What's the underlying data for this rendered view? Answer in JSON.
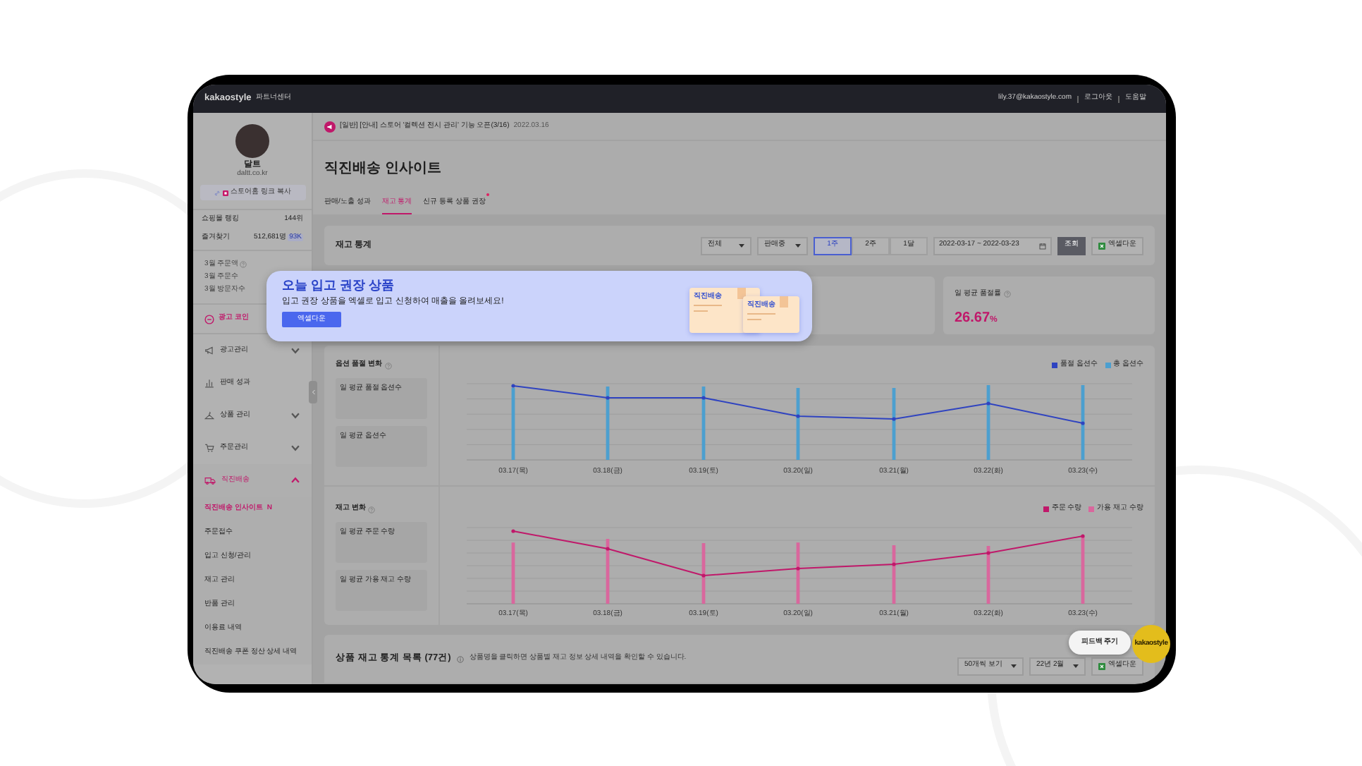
{
  "header": {
    "logo": "kakaostyle",
    "logo_suffix": "파트너센터",
    "links": [
      "lily.37@kakaostyle.com",
      "로그아웃",
      "도움말"
    ]
  },
  "sidebar": {
    "store_name": "달트",
    "store_url": "daltt.co.kr",
    "copy_link_button": "스토어홈 링크 복사",
    "stats": [
      {
        "label": "쇼핑몰 랭킹",
        "value": "144위"
      },
      {
        "label": "즐겨찾기",
        "value": "512,681명",
        "badge": "93K"
      }
    ],
    "monthly": [
      {
        "label": "3월 주문액",
        "help": true
      },
      {
        "label": "3월 주문수",
        "help": false
      },
      {
        "label": "3월 방문자수",
        "help": false
      }
    ],
    "ad_coin": "광고 코인",
    "menu": [
      {
        "label": "광고관리",
        "kind": "group",
        "expanded": false,
        "selected": false
      },
      {
        "label": "판매 성과",
        "kind": "link",
        "selected": false
      },
      {
        "label": "상품 관리",
        "kind": "group",
        "expanded": false,
        "selected": false
      },
      {
        "label": "주문관리",
        "kind": "group",
        "expanded": false,
        "selected": false
      },
      {
        "label": "직진배송",
        "kind": "group",
        "expanded": true,
        "selected": true,
        "children": [
          {
            "label": "직진배송 인사이트",
            "badge": "N",
            "selected": true
          },
          {
            "label": "주문접수",
            "selected": false
          },
          {
            "label": "입고 신청/관리",
            "selected": false
          },
          {
            "label": "재고 관리",
            "selected": false
          },
          {
            "label": "반품 관리",
            "selected": false
          },
          {
            "label": "이용료 내역",
            "selected": false
          },
          {
            "label": "직진배송 쿠폰 정산 상세 내역",
            "selected": false
          }
        ]
      }
    ]
  },
  "notice": {
    "text": "[일반] [안내] 스토어 '컬렉션 전시 관리' 기능 오픈(3/16)",
    "date": "2022.03.16"
  },
  "page_title": "직진배송 인사이트",
  "tabs": [
    {
      "label": "판매/노출 성과",
      "selected": false,
      "new_dot": false
    },
    {
      "label": "재고 통계",
      "selected": true,
      "new_dot": false
    },
    {
      "label": "신규 등록 상품 권장",
      "selected": false,
      "new_dot": true
    }
  ],
  "filter": {
    "title": "재고 통계",
    "selects": [
      "전체",
      "판매중"
    ],
    "periods": [
      {
        "label": "1주",
        "selected": true
      },
      {
        "label": "2주",
        "selected": false
      },
      {
        "label": "1달",
        "selected": false
      }
    ],
    "date_range": "2022-03-17 ~ 2022-03-23",
    "search_button": "조회",
    "excel_button": "엑셀다운"
  },
  "stat": {
    "label": "일 평균 품절률",
    "value": "26.67",
    "unit": "%"
  },
  "charts": [
    {
      "title": "옵션 품절 변화",
      "metrics": [
        "일 평균 품절 옵션수",
        "일 평균 옵션수"
      ],
      "legend": [
        {
          "label": "품절 옵션수",
          "color": "#2f43c0"
        },
        {
          "label": "총 옵션수",
          "color": "#4c9fcf"
        }
      ],
      "x_labels": [
        "03.17(목)",
        "03.18(금)",
        "03.19(토)",
        "03.20(일)",
        "03.21(월)",
        "03.22(화)",
        "03.23(수)"
      ]
    },
    {
      "title": "재고 변화",
      "metrics": [
        "일 평균 주문 수량",
        "일 평균 가용 재고 수량"
      ],
      "legend": [
        {
          "label": "주문 수량",
          "color": "#c0186a"
        },
        {
          "label": "가용 재고 수량",
          "color": "#d9679d"
        }
      ],
      "x_labels": [
        "03.17(목)",
        "03.18(금)",
        "03.19(토)",
        "03.20(일)",
        "03.21(월)",
        "03.22(화)",
        "03.23(수)"
      ]
    }
  ],
  "list": {
    "title": "상품 재고 통계 목록 (77건)",
    "hint": "상품명을 클릭하면 상품별 재고 정보 상세 내역을 확인할 수 있습니다.",
    "page_size": "50개씩 보기",
    "month": "22년 2월",
    "excel_button": "엑셀다운"
  },
  "popup": {
    "title": "오늘 입고 권장 상품",
    "text": "입고 권장 상품을 엑셀로 입고 신청하여 매출을 올려보세요!",
    "button": "엑셀다운",
    "box_labels": [
      "직진배송",
      "직진배송"
    ]
  },
  "feedback_button": "피드백 주기",
  "chat_badge": "kakaostyle"
}
